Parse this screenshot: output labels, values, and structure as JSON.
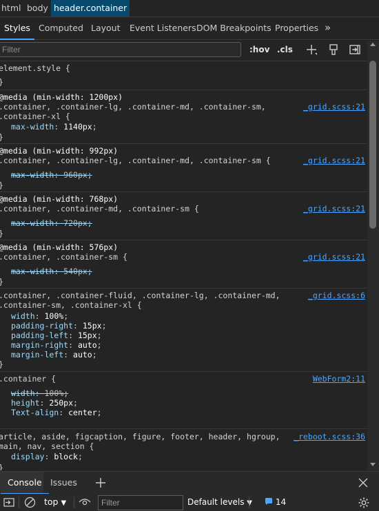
{
  "breadcrumb": [
    "html",
    "body",
    "header.container"
  ],
  "tabs": [
    "Styles",
    "Computed",
    "Layout",
    "Event Listeners",
    "DOM Breakpoints",
    "Properties"
  ],
  "toolbar": {
    "filter_placeholder": "Filter",
    "hov_label": ":hov",
    "cls_label": ".cls"
  },
  "rules": [
    {
      "media": "",
      "selector": [
        "element.style {"
      ],
      "source": "",
      "declarations": [],
      "close": "}"
    },
    {
      "media": "@media (min-width: 1200px)",
      "selector": [
        ".container, .container-lg, .container-md, .container-sm,",
        ".container-xl {"
      ],
      "source": "_grid.scss:21",
      "declarations": [
        {
          "prop": "max-width",
          "value": "1140px",
          "struck": false
        }
      ],
      "close": "}"
    },
    {
      "media": "@media (min-width: 992px)",
      "selector": [
        ".container, .container-lg, .container-md, .container-sm {"
      ],
      "source": "_grid.scss:21",
      "declarations": [
        {
          "prop": "max-width",
          "value": "960px",
          "struck": true
        }
      ],
      "close": "}"
    },
    {
      "media": "@media (min-width: 768px)",
      "selector": [
        ".container, .container-md, .container-sm {"
      ],
      "source": "_grid.scss:21",
      "declarations": [
        {
          "prop": "max-width",
          "value": "720px",
          "struck": true
        }
      ],
      "close": "}"
    },
    {
      "media": "@media (min-width: 576px)",
      "selector": [
        ".container, .container-sm {"
      ],
      "source": "_grid.scss:21",
      "declarations": [
        {
          "prop": "max-width",
          "value": "540px",
          "struck": true
        }
      ],
      "close": "}"
    },
    {
      "media": "",
      "selector": [
        ".container, .container-fluid, .container-lg, .container-md,",
        ".container-sm, .container-xl {"
      ],
      "source": "_grid.scss:6",
      "declarations": [
        {
          "prop": "width",
          "value": "100%",
          "struck": false
        },
        {
          "prop": "padding-right",
          "value": "15px",
          "struck": false
        },
        {
          "prop": "padding-left",
          "value": "15px",
          "struck": false
        },
        {
          "prop": "margin-right",
          "value": "auto",
          "struck": false
        },
        {
          "prop": "margin-left",
          "value": "auto",
          "struck": false
        }
      ],
      "close": "}"
    },
    {
      "media": "",
      "selector": [
        ".container {"
      ],
      "source": "WebForm2:11",
      "declarations": [
        {
          "prop": "width",
          "value": "100%",
          "struck": true
        },
        {
          "prop": "height",
          "value": "250px",
          "struck": false
        },
        {
          "prop": "Text-align",
          "value": "center",
          "struck": false
        }
      ],
      "close": "}"
    },
    {
      "media": "",
      "selector": [
        "article, aside, figcaption, figure, footer, header, hgroup,",
        "main, nav, section {"
      ],
      "source": "_reboot.scss:36",
      "declarations": [
        {
          "prop": "display",
          "value": "block",
          "struck": false
        }
      ],
      "close": "}"
    }
  ],
  "drawer": {
    "tabs": [
      "Console",
      "Issues"
    ],
    "context": "top",
    "filter_placeholder": "Filter",
    "levels": "Default levels",
    "issues_count": "14"
  },
  "colors": {
    "background": "#242424",
    "accent": "#4da6ff",
    "property": "#9cdcfe",
    "selected_crumb": "#084a6e"
  },
  "icons": [
    "add-rule-icon",
    "paint-brush-icon",
    "toggle-sidebar-icon",
    "more-tabs-icon",
    "close-icon",
    "clear-console-icon",
    "eye-icon",
    "settings-gear-icon",
    "issues-icon"
  ]
}
